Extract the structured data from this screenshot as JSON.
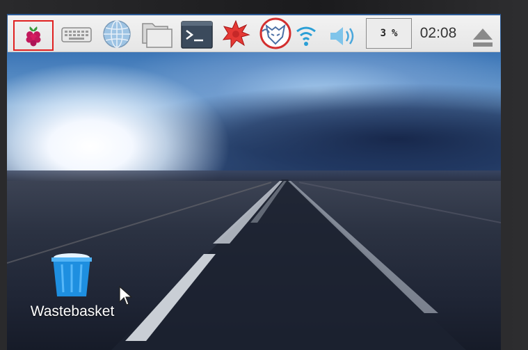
{
  "panel": {
    "menu_icon": "raspberry-icon",
    "launchers": [
      {
        "name": "keyboard",
        "icon": "keyboard-icon"
      },
      {
        "name": "web-browser",
        "icon": "globe-icon"
      },
      {
        "name": "file-manager",
        "icon": "folder-icon"
      },
      {
        "name": "terminal",
        "icon": "terminal-icon"
      },
      {
        "name": "mathematica",
        "icon": "mathematica-icon"
      },
      {
        "name": "wolfram",
        "icon": "wolf-icon"
      }
    ],
    "tray": {
      "wifi_icon": "wifi-icon",
      "volume_icon": "speaker-icon",
      "cpu_value": "3",
      "cpu_unit": "%",
      "clock": "02:08",
      "eject_icon": "eject-icon"
    },
    "highlight_color": "#e02020"
  },
  "desktop": {
    "icons": [
      {
        "label": "Wastebasket",
        "icon": "trash-icon"
      }
    ]
  }
}
